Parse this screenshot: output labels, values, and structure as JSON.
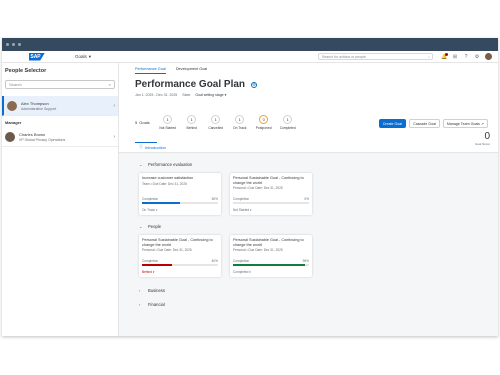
{
  "shell": {
    "logo": "SAP",
    "menu": "Goals",
    "search_placeholder": "Search for actions or people"
  },
  "left": {
    "title": "People Selector",
    "search_placeholder": "Search",
    "selected_person": {
      "name": "Alex Thompson",
      "role": "Administrative Support"
    },
    "manager_label": "Manager",
    "manager": {
      "name": "Charles Brown",
      "role": "VP Global Privacy Operations"
    }
  },
  "tabs": [
    {
      "label": "Performance Goal"
    },
    {
      "label": "Development Goal"
    }
  ],
  "header": {
    "title": "Performance Goal Plan",
    "period": "Jan 1, 2025 - Dec 31, 2025",
    "state_label": "State",
    "state_value": "Goal setting stage"
  },
  "actions": {
    "create": "Create Goal",
    "cascade": "Cascade Goal",
    "manage": "Manage Team Goals"
  },
  "stats": {
    "goals_count": "5",
    "goals_label": "Goals",
    "items": [
      {
        "value": "1",
        "label": "Not Started"
      },
      {
        "value": "1",
        "label": "Behind"
      },
      {
        "value": "1",
        "label": "Cancelled"
      },
      {
        "value": "1",
        "label": "On Track"
      },
      {
        "value": "0",
        "label": "Postponed"
      },
      {
        "value": "1",
        "label": "Completed"
      }
    ],
    "total_value": "0",
    "total_label": "Goal Score"
  },
  "intro": "Introduction",
  "sections": [
    {
      "title": "Performance evaluation",
      "cards": [
        {
          "title": "Increase customer satisfaction",
          "sub": "Team • Due Date: Dec 31, 2025",
          "prog_label": "Completion",
          "prog_value": "50%",
          "status": "On Track",
          "progress": 0.5,
          "color": "#0a6ed1"
        },
        {
          "title": "Personal Sustainable Goal - Continuing to change the world",
          "sub": "Personal • Due Date: Dec 31, 2025",
          "prog_label": "Completion",
          "prog_value": "0%",
          "status": "Not Started",
          "progress": 0,
          "color": "#0a6ed1"
        }
      ]
    },
    {
      "title": "People",
      "cards": [
        {
          "title": "Personal Sustainable Goal - Continuing to change the world",
          "sub": "Personal • Due Date: Dec 31, 2025",
          "prog_label": "Completion",
          "prog_value": "40%",
          "status": "Behind",
          "progress": 0.4,
          "color": "#bb0000"
        },
        {
          "title": "Personal Sustainable Goal - Continuing to change the world",
          "sub": "Personal • Due Date: Dec 31, 2025",
          "prog_label": "Completion",
          "prog_value": "95%",
          "status": "Completed",
          "progress": 0.95,
          "color": "#107e3e"
        }
      ]
    },
    {
      "title": "Business",
      "cards": []
    },
    {
      "title": "Financial",
      "cards": []
    }
  ]
}
